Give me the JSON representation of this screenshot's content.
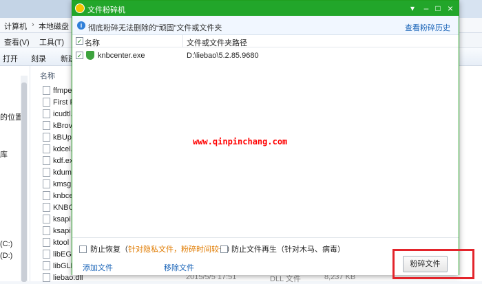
{
  "explorer": {
    "breadcrumb": [
      "计算机",
      "本地磁盘（"
    ],
    "menu": [
      "查看(V)",
      "工具(T)"
    ],
    "toolbar": [
      "打开",
      "刻录",
      "新建"
    ],
    "nav_items": [
      "的位置",
      "库",
      "(C:)",
      "(D:)"
    ],
    "column_name": "名称",
    "files": [
      "ffmpe",
      "First R",
      "icudtl.",
      "kBrov",
      "kBUp",
      "kdcel.",
      "kdf.ex",
      "kdum",
      "kmsg",
      "knbce",
      "KNBC",
      "ksapi",
      "ksapi",
      "ktool",
      "libEG",
      "libGLE",
      "liebao.dll"
    ],
    "bottom_row": {
      "date": "2015/5/5 17:51",
      "type": "DLL 文件",
      "size": "8,237 KB"
    }
  },
  "dialog": {
    "title": "文件粉碎机",
    "info_text": "彻底粉碎无法删除的“顽固”文件或文件夹",
    "history_link": "查看粉碎历史",
    "col_name": "名称",
    "col_path": "文件或文件夹路径",
    "rows": [
      {
        "name": "knbcenter.exe",
        "path": "D:\\liebao\\5.2.85.9680",
        "checked": true
      }
    ],
    "watermark": "www.qinpinchang.com",
    "opt1_label": "防止恢复（",
    "opt1_note": "针对隐私文件，粉碎时间较长",
    "opt1_close": "）",
    "opt2_label": "防止文件再生（针对木马、病毒）",
    "add_file": "添加文件",
    "remove_file": "移除文件",
    "shred_button": "粉碎文件",
    "window_buttons": {
      "menu": "▾",
      "min": "–",
      "max": "□",
      "close": "×"
    }
  },
  "colors": {
    "title_green": "#22a62a",
    "highlight_red": "#e3242b",
    "note_orange": "#e07b00"
  }
}
